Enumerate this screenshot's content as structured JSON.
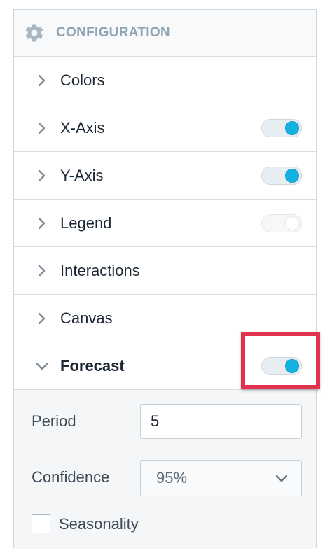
{
  "header": {
    "title": "CONFIGURATION",
    "icon": "gear-icon"
  },
  "sections": [
    {
      "label": "Colors",
      "expanded": false,
      "toggle": null
    },
    {
      "label": "X-Axis",
      "expanded": false,
      "toggle": "on"
    },
    {
      "label": "Y-Axis",
      "expanded": false,
      "toggle": "on"
    },
    {
      "label": "Legend",
      "expanded": false,
      "toggle": "disabled"
    },
    {
      "label": "Interactions",
      "expanded": false,
      "toggle": null
    },
    {
      "label": "Canvas",
      "expanded": false,
      "toggle": null
    },
    {
      "label": "Forecast",
      "expanded": true,
      "toggle": "on"
    }
  ],
  "forecast": {
    "period_label": "Period",
    "period_value": "5",
    "confidence_label": "Confidence",
    "confidence_value": "95%",
    "seasonality_label": "Seasonality",
    "seasonality_checked": false
  },
  "colors": {
    "toggle_on": "#14b2e2",
    "highlight": "#e2334e",
    "header_text": "#8fa3b3"
  }
}
